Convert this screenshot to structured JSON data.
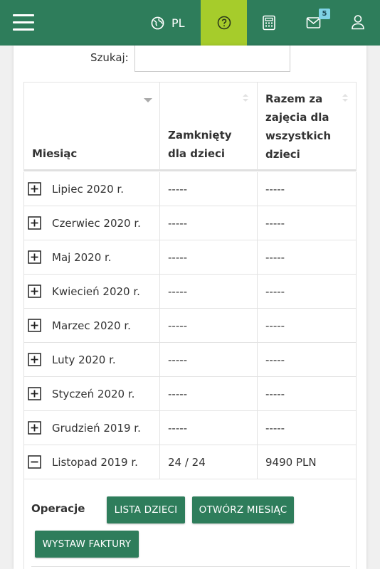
{
  "header": {
    "language_label": "PL",
    "mail_badge": "5",
    "icons": [
      "menu-icon",
      "globe-icon",
      "help-icon",
      "calculator-icon",
      "mail-icon",
      "user-icon"
    ],
    "accent_color": "#2e7d5b",
    "help_bg_color": "#a6cc2b"
  },
  "search": {
    "label": "Szukaj:",
    "value": "",
    "placeholder": ""
  },
  "table": {
    "headers": {
      "month": "Miesiąc",
      "closed": "Zamknięty dla dzieci",
      "total": "Razem za zajęcia dla wszystkich dzieci"
    },
    "rows": [
      {
        "month": "Lipiec 2020 r.",
        "closed": "-----",
        "total": "-----",
        "expanded": false
      },
      {
        "month": "Czerwiec 2020 r.",
        "closed": "-----",
        "total": "-----",
        "expanded": false
      },
      {
        "month": "Maj 2020 r.",
        "closed": "-----",
        "total": "-----",
        "expanded": false
      },
      {
        "month": "Kwiecień 2020 r.",
        "closed": "-----",
        "total": "-----",
        "expanded": false
      },
      {
        "month": "Marzec 2020 r.",
        "closed": "-----",
        "total": "-----",
        "expanded": false
      },
      {
        "month": "Luty 2020 r.",
        "closed": "-----",
        "total": "-----",
        "expanded": false
      },
      {
        "month": "Styczeń 2020 r.",
        "closed": "-----",
        "total": "-----",
        "expanded": false
      },
      {
        "month": "Grudzień 2019 r.",
        "closed": "-----",
        "total": "-----",
        "expanded": false
      },
      {
        "month": "Listopad 2019 r.",
        "closed": "24 / 24",
        "total": "9490 PLN",
        "expanded": true
      }
    ]
  },
  "operations": {
    "label": "Operacje",
    "buttons": {
      "list_children": "LISTA DZIECI",
      "open_month": "OTWÓRZ MIESIĄC",
      "issue_invoices": "WYSTAW FAKTURY"
    }
  }
}
